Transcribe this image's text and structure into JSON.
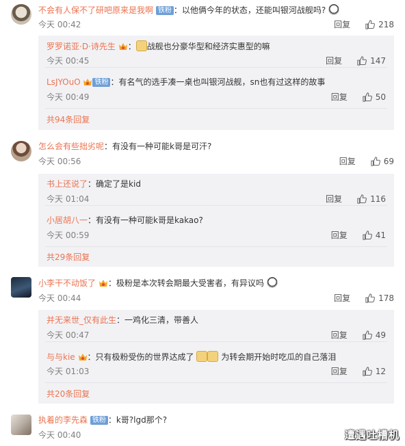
{
  "comments": [
    {
      "username": "不会有人保不了研吧原来是我啊",
      "badge": "铁粉",
      "text": "以他俩今年的状态，还能叫银河战舰吗?",
      "time": "今天 00:42",
      "reply_label": "回复",
      "likes": "218",
      "replies": [
        {
          "username": "罗罗诺亚·D·诗先生",
          "text": "战舰也分豪华型和经济实惠型的嘛",
          "time": "今天 00:45",
          "reply_label": "回复",
          "likes": "147"
        },
        {
          "username": "LsJYOuO",
          "badge": "铁粉",
          "text": "有名气的选手凑一桌也叫银河战舰，sn也有过这样的故事",
          "time": "今天 00:49",
          "reply_label": "回复",
          "likes": "50"
        }
      ],
      "more_label": "共94条回复"
    },
    {
      "username": "怎么会有些拙劣呢",
      "text": "有没有一种可能k哥是可汗?",
      "time": "今天 00:56",
      "reply_label": "回复",
      "likes": "69",
      "replies": [
        {
          "username": "书上还说了",
          "text": "确定了是kid",
          "time": "今天 01:04",
          "reply_label": "回复",
          "likes": "116"
        },
        {
          "username": "小居胡八一",
          "text": "有没有一种可能k哥是kakao?",
          "time": "今天 00:59",
          "reply_label": "回复",
          "likes": "41"
        }
      ],
      "more_label": "共29条回复"
    },
    {
      "username": "小李干不动饭了",
      "text": "极粉是本次转会期最大受害者，有异议吗",
      "time": "今天 00:44",
      "reply_label": "回复",
      "likes": "178",
      "replies": [
        {
          "username": "并无来世_仅有此生",
          "text": "一鸡化三清，带善人",
          "time": "今天 00:47",
          "reply_label": "回复",
          "likes": "49"
        },
        {
          "username": "与与kie",
          "text": "只有极粉受伤的世界达成了",
          "text2": "为转会期开始时吃瓜的自己落泪",
          "time": "今天 01:03",
          "reply_label": "回复",
          "likes": "12"
        }
      ],
      "more_label": "共20条回复"
    },
    {
      "username": "执着的李先森",
      "badge": "铁粉",
      "text": "k哥?lgd那个?",
      "time": "今天 00:40"
    }
  ],
  "watermark": "遭遇吐槽机",
  "colors": {
    "username": "#eb7350",
    "badge": "#6f9fd8",
    "sub_background": "#f2f2f5"
  }
}
